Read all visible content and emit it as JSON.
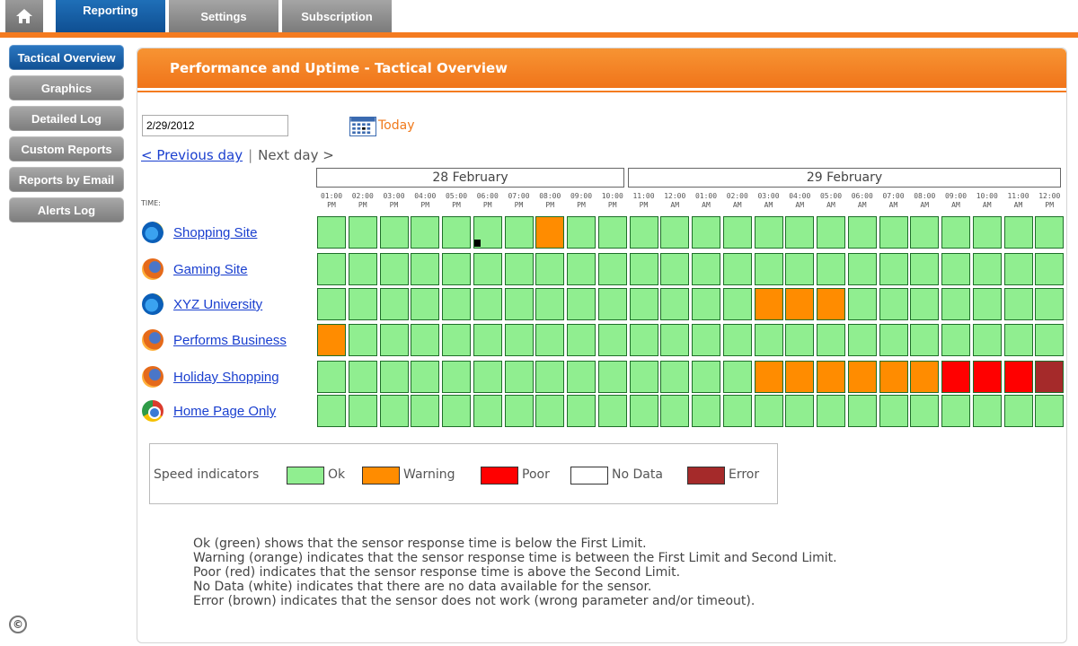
{
  "nav": {
    "home_icon": "home-icon",
    "tabs": [
      {
        "label": "Reporting",
        "active": true
      },
      {
        "label": "Settings",
        "active": false
      },
      {
        "label": "Subscription",
        "active": false
      }
    ]
  },
  "sidebar": {
    "items": [
      {
        "label": "Tactical Overview",
        "active": true
      },
      {
        "label": "Graphics",
        "active": false
      },
      {
        "label": "Detailed Log",
        "active": false
      },
      {
        "label": "Custom Reports",
        "active": false
      },
      {
        "label": "Reports by Email",
        "active": false
      },
      {
        "label": "Alerts Log",
        "active": false
      }
    ],
    "copyright_symbol": "©"
  },
  "panel": {
    "title": "Performance and Uptime - Tactical Overview",
    "date_value": "2/29/2012",
    "today_label": "Today",
    "prev_day": "< Previous day",
    "separator": "|",
    "next_day": "Next day >",
    "time_label": "TIME:",
    "dates": [
      "28 February",
      "29 February"
    ],
    "times": [
      [
        "01:00",
        "PM"
      ],
      [
        "02:00",
        "PM"
      ],
      [
        "03:00",
        "PM"
      ],
      [
        "04:00",
        "PM"
      ],
      [
        "05:00",
        "PM"
      ],
      [
        "06:00",
        "PM"
      ],
      [
        "07:00",
        "PM"
      ],
      [
        "08:00",
        "PM"
      ],
      [
        "09:00",
        "PM"
      ],
      [
        "10:00",
        "PM"
      ],
      [
        "11:00",
        "PM"
      ],
      [
        "12:00",
        "AM"
      ],
      [
        "01:00",
        "AM"
      ],
      [
        "02:00",
        "AM"
      ],
      [
        "03:00",
        "AM"
      ],
      [
        "04:00",
        "AM"
      ],
      [
        "05:00",
        "AM"
      ],
      [
        "06:00",
        "AM"
      ],
      [
        "07:00",
        "AM"
      ],
      [
        "08:00",
        "AM"
      ],
      [
        "09:00",
        "AM"
      ],
      [
        "10:00",
        "AM"
      ],
      [
        "11:00",
        "AM"
      ],
      [
        "12:00",
        "PM"
      ]
    ],
    "sites": [
      {
        "name": "Shopping Site",
        "icon": "ie",
        "status": [
          "ok",
          "ok",
          "ok",
          "ok",
          "ok",
          "ok",
          "ok",
          "warn",
          "ok",
          "ok",
          "ok",
          "ok",
          "ok",
          "ok",
          "ok",
          "ok",
          "ok",
          "ok",
          "ok",
          "ok",
          "ok",
          "ok",
          "ok",
          "ok"
        ]
      },
      {
        "name": "Gaming Site",
        "icon": "ff",
        "status": [
          "ok",
          "ok",
          "ok",
          "ok",
          "ok",
          "ok",
          "ok",
          "ok",
          "ok",
          "ok",
          "ok",
          "ok",
          "ok",
          "ok",
          "ok",
          "ok",
          "ok",
          "ok",
          "ok",
          "ok",
          "ok",
          "ok",
          "ok",
          "ok"
        ]
      },
      {
        "name": "XYZ University",
        "icon": "ie",
        "status": [
          "ok",
          "ok",
          "ok",
          "ok",
          "ok",
          "ok",
          "ok",
          "ok",
          "ok",
          "ok",
          "ok",
          "ok",
          "ok",
          "ok",
          "warn",
          "warn",
          "warn",
          "ok",
          "ok",
          "ok",
          "ok",
          "ok",
          "ok",
          "ok"
        ]
      },
      {
        "name": "Performs Business",
        "icon": "ff",
        "status": [
          "warn",
          "ok",
          "ok",
          "ok",
          "ok",
          "ok",
          "ok",
          "ok",
          "ok",
          "ok",
          "ok",
          "ok",
          "ok",
          "ok",
          "ok",
          "ok",
          "ok",
          "ok",
          "ok",
          "ok",
          "ok",
          "ok",
          "ok",
          "ok"
        ]
      },
      {
        "name": "Holiday Shopping",
        "icon": "ff",
        "status": [
          "ok",
          "ok",
          "ok",
          "ok",
          "ok",
          "ok",
          "ok",
          "ok",
          "ok",
          "ok",
          "ok",
          "ok",
          "ok",
          "ok",
          "warn",
          "warn",
          "warn",
          "warn",
          "warn",
          "warn",
          "poor",
          "poor",
          "poor",
          "error"
        ]
      },
      {
        "name": "Home Page Only",
        "icon": "ch",
        "status": [
          "ok",
          "ok",
          "ok",
          "ok",
          "ok",
          "ok",
          "ok",
          "ok",
          "ok",
          "ok",
          "ok",
          "ok",
          "ok",
          "ok",
          "ok",
          "ok",
          "ok",
          "ok",
          "ok",
          "ok",
          "ok",
          "ok",
          "ok",
          "ok"
        ]
      }
    ],
    "colors": {
      "ok": "#90ee90",
      "warn": "#ff8c00",
      "poor": "#ff0000",
      "nodata": "#ffffff",
      "error": "#a52a2a"
    },
    "legend": {
      "title": "Speed indicators",
      "items": [
        {
          "key": "ok",
          "label": "Ok"
        },
        {
          "key": "warn",
          "label": "Warning"
        },
        {
          "key": "poor",
          "label": "Poor"
        },
        {
          "key": "nodata",
          "label": "No Data"
        },
        {
          "key": "error",
          "label": "Error"
        }
      ]
    },
    "descriptions": [
      "Ok (green)  shows that the sensor response time is below the First Limit.",
      "Warning (orange)  indicates that the sensor response time is between the First Limit and Second Limit.",
      "Poor (red)  indicates that the sensor response time is above the Second Limit.",
      "No Data (white)  indicates that there are no data available for the sensor.",
      "Error (brown)  indicates that the sensor does not work (wrong parameter and/or timeout)."
    ]
  }
}
